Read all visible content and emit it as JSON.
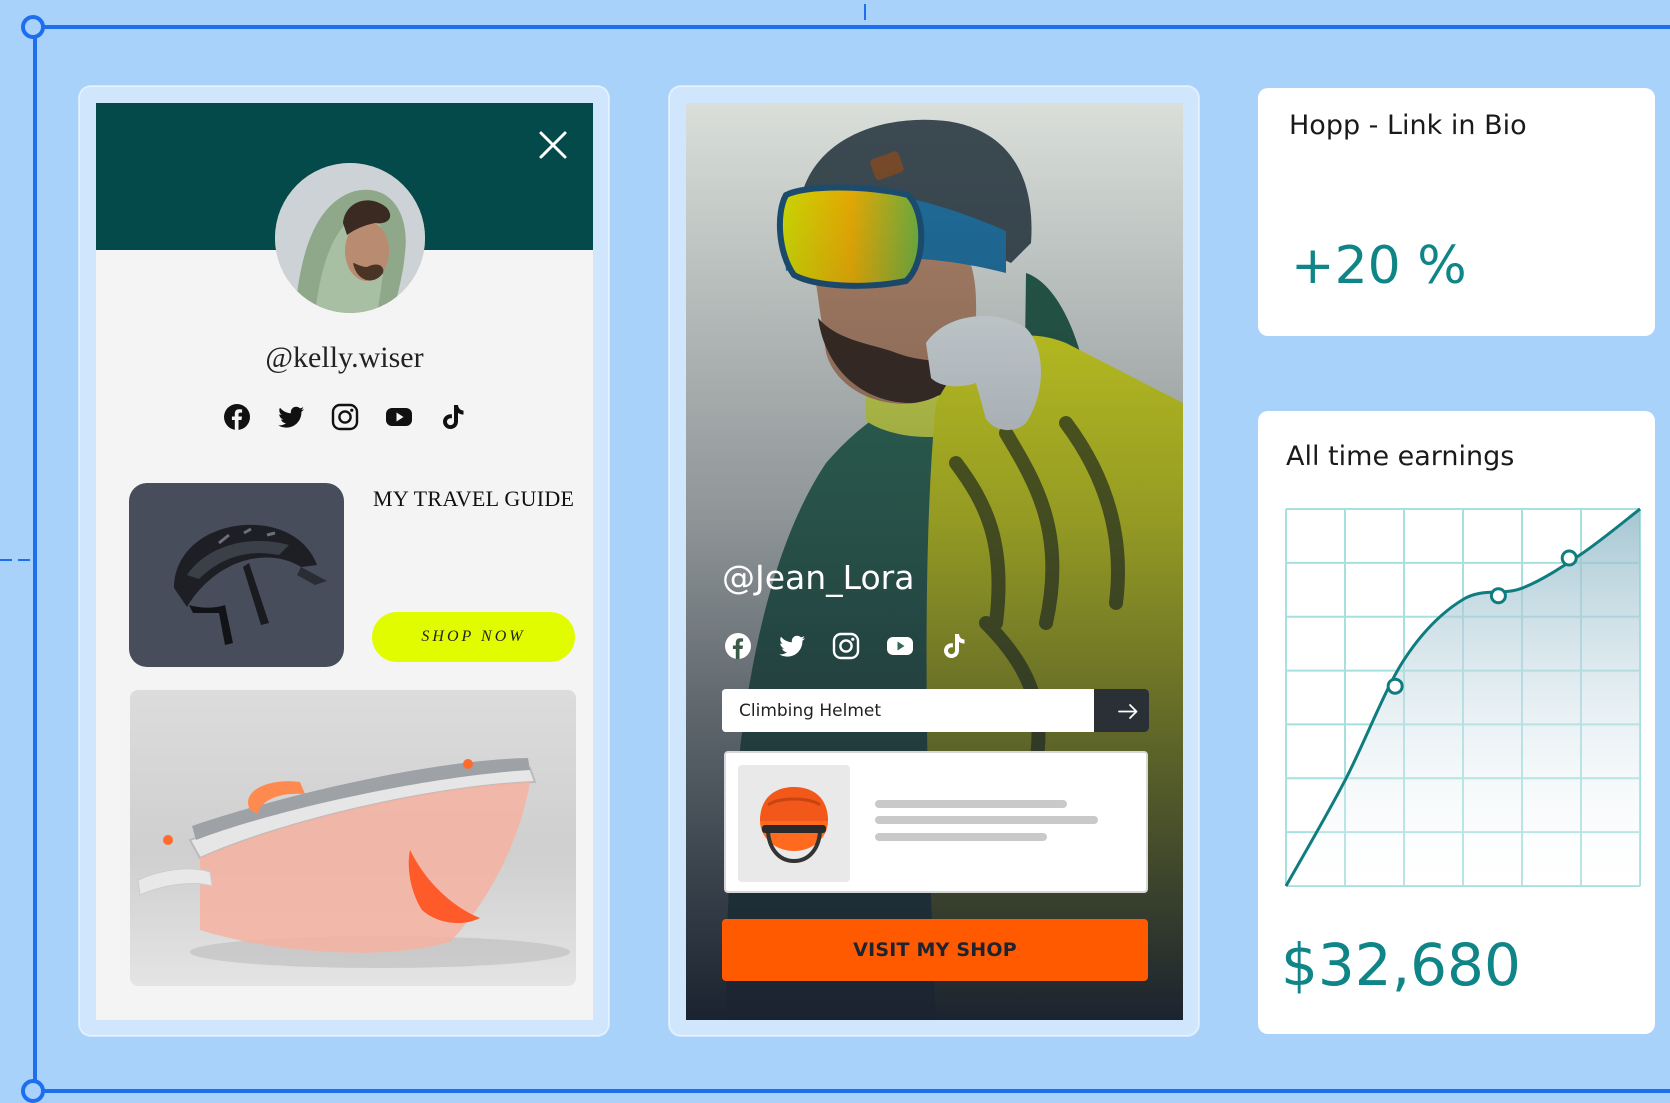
{
  "colors": {
    "background": "#a9d2fb",
    "guide": "#1e6ff0",
    "header_teal": "#044a4a",
    "accent_lime": "#e2fc00",
    "accent_orange": "#ff5a00",
    "stat_teal": "#0f8587"
  },
  "card1": {
    "handle": "@kelly.wiser",
    "social_icons": [
      "facebook-icon",
      "twitter-icon",
      "instagram-icon",
      "youtube-icon",
      "tiktok-icon"
    ],
    "guide_title": "MY TRAVEL GUIDE",
    "shop_button": "SHOP NOW"
  },
  "card2": {
    "handle": "@Jean_Lora",
    "social_icons": [
      "facebook-icon",
      "twitter-icon",
      "instagram-icon",
      "youtube-icon",
      "tiktok-icon"
    ],
    "search_value": "Climbing Helmet",
    "visit_button": "VISIT MY SHOP"
  },
  "stat1": {
    "label": "Hopp - Link in Bio",
    "value": "+20 %"
  },
  "stat2": {
    "label": "All time earnings",
    "value": "$32,680"
  },
  "chart_data": {
    "type": "area",
    "title": "",
    "xlabel": "",
    "ylabel": "",
    "grid": true,
    "x": [
      0,
      1,
      2,
      3,
      4,
      5,
      6
    ],
    "y": [
      0,
      0.28,
      0.6,
      0.76,
      0.79,
      0.88,
      1.0
    ],
    "markers": [
      {
        "x": 1.85,
        "y": 0.53
      },
      {
        "x": 3.6,
        "y": 0.77
      },
      {
        "x": 4.8,
        "y": 0.87
      }
    ],
    "xlim": [
      0,
      6
    ],
    "ylim": [
      0,
      1
    ]
  }
}
